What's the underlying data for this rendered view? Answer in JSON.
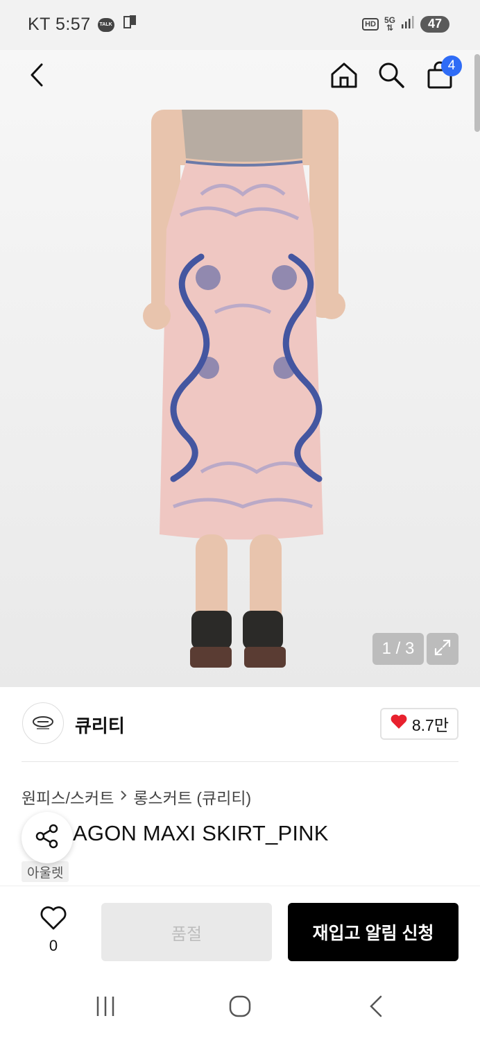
{
  "status_bar": {
    "carrier": "KT",
    "time": "5:57",
    "talk_label": "TALK",
    "hd": "HD",
    "network": "5G",
    "battery": "47"
  },
  "nav": {
    "cart_count": "4"
  },
  "gallery": {
    "counter": "1 / 3"
  },
  "brand": {
    "name": "큐리티",
    "likes": "8.7만"
  },
  "product": {
    "breadcrumb": [
      "원피스/스커트",
      "롱스커트 (큐리티)"
    ],
    "title_visible": "AGON MAXI SKIRT_PINK",
    "tag": "아울렛"
  },
  "bottom_bar": {
    "wish_count": "0",
    "soldout_label": "품절",
    "restock_label": "재입고 알림 신청"
  },
  "colors": {
    "accent_blue": "#2f6cf6",
    "like_red": "#e8212e",
    "cta_black": "#000000"
  },
  "icons": {
    "back": "chevron-left-icon",
    "home": "home-icon",
    "search": "search-icon",
    "cart": "shopping-bag-icon",
    "share": "share-icon",
    "wish": "heart-outline-icon",
    "expand": "expand-icon"
  }
}
